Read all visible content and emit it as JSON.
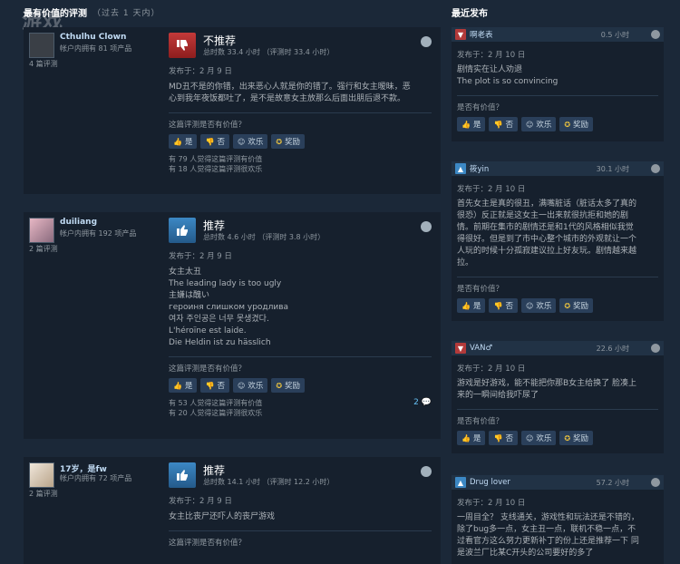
{
  "left_header": {
    "title": "最有价值的评测",
    "subtitle": "（过去 1 天内）"
  },
  "right_header": {
    "title": "最近发布"
  },
  "watermark_text": "游戏",
  "reviews": [
    {
      "author": "Cthulhu Clown",
      "owned": "帐户内拥有 81 项产品",
      "review_count": "4 篇评测",
      "verdict": "不推荐",
      "verdict_type": "down",
      "hours": "总时数 33.4 小时  （评测时 33.4 小时）",
      "posted": "发布于：2 月 9 日",
      "content": [
        "MD丑不是的你错，出来恶心人就是你的错了。强行和女主暧昧，恶",
        "心到我年夜饭都吐了，是不是故意女主放那么后面出朋后退不款。"
      ],
      "helpful_q": "这篇评测是否有价值？",
      "buttons": {
        "yes": "是",
        "no": "否",
        "funny": "欢乐",
        "award": "奖励"
      },
      "stats": [
        "有 79 人觉得这篇评测有价值",
        "有 18 人觉得这篇评测很欢乐"
      ]
    },
    {
      "author": "duiliang",
      "owned": "帐户内拥有 192 项产品",
      "review_count": "2 篇评测",
      "verdict": "推荐",
      "verdict_type": "up",
      "hours": "总时数 4.6 小时  （评测时 3.8 小时）",
      "posted": "发布于：2 月 9 日",
      "content": [
        "女主太丑",
        "The leading lady is too ugly",
        "主嫌は醜い",
        "героиня слишком уродлива",
        "여자 주인공은 너무 못생겼다.",
        "L'héroïne est laide.",
        "Die Heldin ist zu hässlich"
      ],
      "helpful_q": "这篇评测是否有价值？",
      "buttons": {
        "yes": "是",
        "no": "否",
        "funny": "欢乐",
        "award": "奖励"
      },
      "stats": [
        "有 53 人觉得这篇评测有价值",
        "有 20 人觉得这篇评测很欢乐"
      ],
      "comments": "2"
    },
    {
      "author": "17岁，是fw",
      "owned": "帐户内拥有 72 项产品",
      "review_count": "2 篇评测",
      "verdict": "推荐",
      "verdict_type": "up",
      "hours": "总时数 14.1 小时  （评测时 12.2 小时）",
      "posted": "发布于：2 月 9 日",
      "content": [
        "女主比丧尸还吓人的丧尸游戏"
      ],
      "helpful_q": "这篇评测是否有价值？"
    }
  ],
  "recent": [
    {
      "author": "啊老表",
      "hours": "0.5 小时",
      "verdict_type": "down",
      "posted": "发布于：2 月 10 日",
      "content": [
        "剧情实在让人劝退",
        "The plot is so convincing"
      ],
      "helpful_q": "是否有价值？",
      "buttons": {
        "yes": "是",
        "no": "否",
        "funny": "欢乐",
        "award": "奖励"
      }
    },
    {
      "author": "筱yin",
      "hours": "30.1 小时",
      "verdict_type": "up",
      "posted": "发布于：2 月 10 日",
      "content": [
        "首先女主是真的很丑，满嘴脏话（脏话太多了真的",
        "很恐）反正就是这女主一出来就很抗拒和她的剧",
        "情。前期在集市的剧情还是和1代的风格相似我觉",
        "得很好。但是到了市中心整个城市的外观就让一个",
        "人玩的时候十分孤寂建议拉上好友玩。剧情越来越",
        "拉。"
      ],
      "helpful_q": "是否有价值？",
      "buttons": {
        "yes": "是",
        "no": "否",
        "funny": "欢乐",
        "award": "奖励"
      }
    },
    {
      "author": "VAN♂",
      "hours": "22.6 小时",
      "verdict_type": "down",
      "posted": "发布于：2 月 10 日",
      "content": [
        "游戏是好游戏，能不能把你那B女主给换了 脸凑上",
        "来的一瞬间给我吓尿了"
      ],
      "helpful_q": "是否有价值？",
      "buttons": {
        "yes": "是",
        "no": "否",
        "funny": "欢乐",
        "award": "奖励"
      }
    },
    {
      "author": "Drug lover",
      "hours": "57.2 小时",
      "verdict_type": "up",
      "posted": "发布于：2 月 10 日",
      "content": [
        "一周目全？ 支线通关，游戏性和玩法还是不错的，",
        "除了bug多一点，女主丑一点，联机不稳一点，不",
        "过看官方这么努力更新补丁的份上还是推荐一下 同",
        "是波兰厂比某C开头的公司要好的多了"
      ]
    }
  ]
}
